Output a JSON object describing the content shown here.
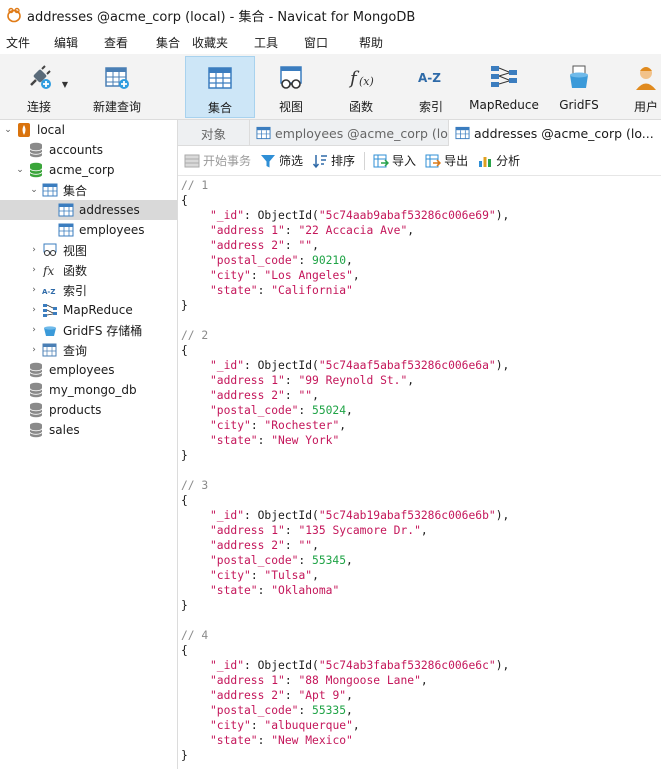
{
  "window": {
    "title": "addresses @acme_corp (local) - 集合 - Navicat for MongoDB"
  },
  "menu": [
    "文件",
    "编辑",
    "查看",
    "集合",
    "收藏夹",
    "工具",
    "窗口",
    "帮助"
  ],
  "toolbar": {
    "connect": "连接",
    "new_query": "新建查询",
    "collection": "集合",
    "view": "视图",
    "function": "函数",
    "index": "索引",
    "mapreduce": "MapReduce",
    "gridfs": "GridFS",
    "user": "用户"
  },
  "sidebar": {
    "local": "local",
    "accounts": "accounts",
    "acme_corp": "acme_corp",
    "collections": "集合",
    "addresses": "addresses",
    "employees_coll": "employees",
    "views": "视图",
    "functions": "函数",
    "indexes": "索引",
    "mapreduce": "MapReduce",
    "gridfs": "GridFS 存储桶",
    "queries": "查询",
    "employees": "employees",
    "my_mongo_db": "my_mongo_db",
    "products": "products",
    "sales": "sales"
  },
  "tabs": {
    "objects": "对象",
    "tab_employees": "employees @acme_corp (lo...",
    "tab_addresses": "addresses @acme_corp (lo..."
  },
  "actions": {
    "begin_transaction": "开始事务",
    "filter": "筛选",
    "sort": "排序",
    "import": "导入",
    "export": "导出",
    "analyze": "分析"
  },
  "documents": [
    {
      "comment": "// 1",
      "id": "5c74aab9abaf53286c006e69",
      "address1": "22 Accacia Ave",
      "address2": "",
      "postal_code": "90210",
      "city": "Los Angeles",
      "state": "California"
    },
    {
      "comment": "// 2",
      "id": "5c74aaf5abaf53286c006e6a",
      "address1": "99 Reynold St.",
      "address2": "",
      "postal_code": "55024",
      "city": "Rochester",
      "state": "New York"
    },
    {
      "comment": "// 3",
      "id": "5c74ab19abaf53286c006e6b",
      "address1": "135 Sycamore Dr.",
      "address2": "",
      "postal_code": "55345",
      "city": "Tulsa",
      "state": "Oklahoma"
    },
    {
      "comment": "// 4",
      "id": "5c74ab3fabaf53286c006e6c",
      "address1": "88 Mongoose Lane",
      "address2": "Apt 9",
      "postal_code": "55335",
      "city": "albuquerque",
      "state": "New Mexico"
    }
  ]
}
